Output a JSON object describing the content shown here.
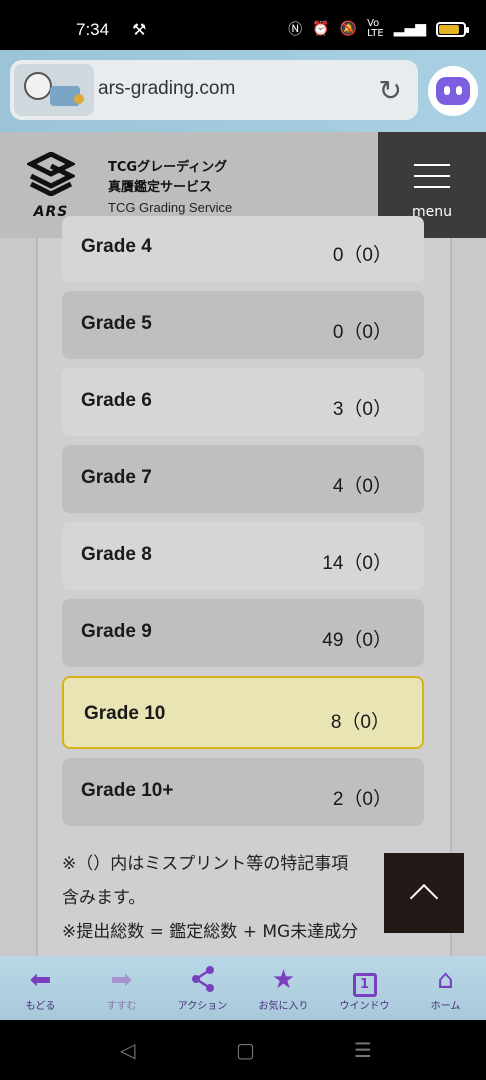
{
  "status": {
    "time": "7:34",
    "left_icon": "hammer-icon",
    "battery_color": "#e6b422"
  },
  "browser": {
    "url": "ars-grading.com",
    "reload_icon": "reload-icon",
    "assistant_icon": "assistant-icon"
  },
  "header": {
    "logo_text": "ARS",
    "brand_line1": "TCGグレーディング",
    "brand_line2": "真贋鑑定サービス",
    "brand_line3": "TCG Grading Service",
    "menu_label": "menu"
  },
  "grades": [
    {
      "label": "Grade 4",
      "value": "0（0）"
    },
    {
      "label": "Grade 5",
      "value": "0（0）"
    },
    {
      "label": "Grade 6",
      "value": "3（0）"
    },
    {
      "label": "Grade 7",
      "value": "4（0）"
    },
    {
      "label": "Grade 8",
      "value": "14（0）"
    },
    {
      "label": "Grade 9",
      "value": "49（0）"
    },
    {
      "label": "Grade 10",
      "value": "8（0）"
    },
    {
      "label": "Grade 10+",
      "value": "2（0）"
    }
  ],
  "notes": {
    "line1": "※（）内はミスプリント等の特記事項",
    "line2": "含みます。",
    "line3": "※提出総数 = 鑑定総数 + MG未達成分"
  },
  "toolbar": {
    "back": "もどる",
    "forward": "すすむ",
    "action": "アクション",
    "favorites": "お気に入り",
    "window": "ウインドウ",
    "window_count": "1",
    "home": "ホーム"
  },
  "colors": {
    "accent": "#7a3fbf",
    "highlight_border": "#d4b21a",
    "highlight_bg": "#e8e4b4"
  }
}
